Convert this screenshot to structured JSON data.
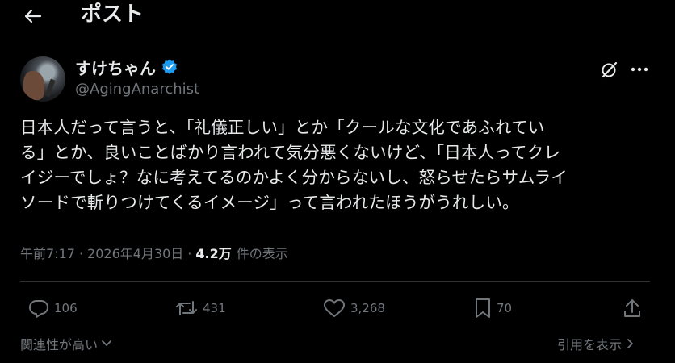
{
  "header": {
    "title": "ポスト",
    "back_icon": "arrow-left-icon"
  },
  "author": {
    "display_name": "すけちゃん",
    "handle": "@AgingAnarchist",
    "verified": true,
    "verified_color": "#1d9bf0"
  },
  "tweet": {
    "lines": [
      "日本人だって言うと、「礼儀正しい」とか「クールな文化であふれてい",
      "る」とか、良いことばかり言われて気分悪くないけど、「日本人ってクレ",
      "イジーでしょ？なに考えてるのかよく分からないし、怒らせたらサムライ",
      "ソードで斬りつけてくるイメージ」って言われたほうがうれしい。"
    ]
  },
  "meta": {
    "time": "午前7:17",
    "separator": "·",
    "date": "2026年4月30日",
    "views_count": "4.2万",
    "views_label": "件の表示"
  },
  "actions": {
    "replies": "106",
    "reposts": "431",
    "likes": "3,268",
    "bookmarks": "70"
  },
  "footer": {
    "sort_label": "関連性が高い",
    "quotes_label": "引用を表示"
  },
  "colors": {
    "background": "#000000",
    "text_primary": "#e7e9ea",
    "text_secondary": "#71767b",
    "divider": "#2f3336"
  }
}
